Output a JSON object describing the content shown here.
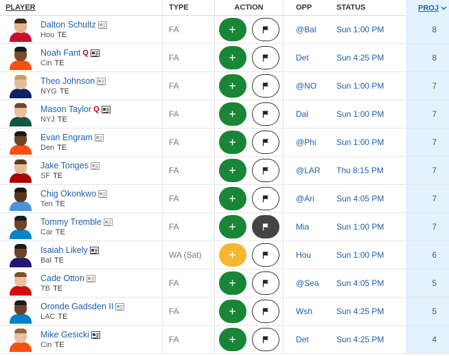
{
  "header": {
    "player": "PLAYER",
    "type": "TYPE",
    "action": "ACTION",
    "opp": "OPP",
    "status": "STATUS",
    "proj": "PROJ"
  },
  "actions": {
    "add_symbol": "+"
  },
  "colors": {
    "link_blue": "#1b5fa8",
    "add_green": "#188537",
    "waiver_yellow": "#f5b731",
    "proj_bg": "#e3f2fd",
    "injury_red": "#c60000"
  },
  "rows": [
    {
      "name": "Dalton Schultz",
      "injury": "",
      "news_active": false,
      "team": "Hou",
      "pos": "TE",
      "type": "FA",
      "waiver": false,
      "flag_active": false,
      "opp": "@Bal",
      "status": "Sun 1:00 PM",
      "proj": "8",
      "jersey": "#c8102e",
      "skin": "#e2b48f",
      "hair": "#3a2a1c"
    },
    {
      "name": "Noah Fant",
      "injury": "Q",
      "news_active": true,
      "team": "Cin",
      "pos": "TE",
      "type": "FA",
      "waiver": false,
      "flag_active": false,
      "opp": "Det",
      "status": "Sun 4:25 PM",
      "proj": "8",
      "jersey": "#fb4f14",
      "skin": "#7a4a2c",
      "hair": "#1a1a1a"
    },
    {
      "name": "Theo Johnson",
      "injury": "",
      "news_active": false,
      "team": "NYG",
      "pos": "TE",
      "type": "FA",
      "waiver": false,
      "flag_active": false,
      "opp": "@NO",
      "status": "Sun 1:00 PM",
      "proj": "7",
      "jersey": "#0b2265",
      "skin": "#e6bc98",
      "hair": "#c9a061"
    },
    {
      "name": "Mason Taylor",
      "injury": "Q",
      "news_active": true,
      "team": "NYJ",
      "pos": "TE",
      "type": "FA",
      "waiver": false,
      "flag_active": false,
      "opp": "Dal",
      "status": "Sun 1:00 PM",
      "proj": "7",
      "jersey": "#125740",
      "skin": "#e8c19f",
      "hair": "#6b4a2a"
    },
    {
      "name": "Evan Engram",
      "injury": "",
      "news_active": false,
      "team": "Den",
      "pos": "TE",
      "type": "FA",
      "waiver": false,
      "flag_active": false,
      "opp": "@Phi",
      "status": "Sun 1:00 PM",
      "proj": "7",
      "jersey": "#fb4f14",
      "skin": "#6e4329",
      "hair": "#1a1a1a"
    },
    {
      "name": "Jake Tonges",
      "injury": "",
      "news_active": false,
      "team": "SF",
      "pos": "TE",
      "type": "FA",
      "waiver": false,
      "flag_active": false,
      "opp": "@LAR",
      "status": "Thu 8:15 PM",
      "proj": "7",
      "jersey": "#aa0000",
      "skin": "#e6bc98",
      "hair": "#5a3c22"
    },
    {
      "name": "Chig Okonkwo",
      "injury": "",
      "news_active": false,
      "team": "Ten",
      "pos": "TE",
      "type": "FA",
      "waiver": false,
      "flag_active": false,
      "opp": "@Ari",
      "status": "Sun 4:05 PM",
      "proj": "7",
      "jersey": "#4b92db",
      "skin": "#5a3522",
      "hair": "#1a1a1a"
    },
    {
      "name": "Tommy Tremble",
      "injury": "",
      "news_active": false,
      "team": "Car",
      "pos": "TE",
      "type": "FA",
      "waiver": false,
      "flag_active": true,
      "opp": "Mia",
      "status": "Sun 1:00 PM",
      "proj": "7",
      "jersey": "#0085ca",
      "skin": "#6e4329",
      "hair": "#1a1a1a"
    },
    {
      "name": "Isaiah Likely",
      "injury": "",
      "news_active": true,
      "team": "Bal",
      "pos": "TE",
      "type": "WA (Sat)",
      "waiver": true,
      "flag_active": false,
      "opp": "Hou",
      "status": "Sun 1:00 PM",
      "proj": "6",
      "jersey": "#241773",
      "skin": "#6e4329",
      "hair": "#1a1a1a"
    },
    {
      "name": "Cade Otton",
      "injury": "",
      "news_active": false,
      "team": "TB",
      "pos": "TE",
      "type": "FA",
      "waiver": false,
      "flag_active": false,
      "opp": "@Sea",
      "status": "Sun 4:05 PM",
      "proj": "5",
      "jersey": "#d50a0a",
      "skin": "#e8c19f",
      "hair": "#7a5232"
    },
    {
      "name": "Oronde Gadsden II",
      "injury": "",
      "news_active": false,
      "team": "LAC",
      "pos": "TE",
      "type": "FA",
      "waiver": false,
      "flag_active": false,
      "opp": "Wsh",
      "status": "Sun 4:25 PM",
      "proj": "5",
      "jersey": "#0080c6",
      "skin": "#6e4329",
      "hair": "#1a1a1a"
    },
    {
      "name": "Mike Gesicki",
      "injury": "",
      "news_active": true,
      "team": "Cin",
      "pos": "TE",
      "type": "FA",
      "waiver": false,
      "flag_active": false,
      "opp": "Det",
      "status": "Sun 4:25 PM",
      "proj": "4",
      "jersey": "#fb4f14",
      "skin": "#e8c19f",
      "hair": "#8a6a44"
    }
  ]
}
